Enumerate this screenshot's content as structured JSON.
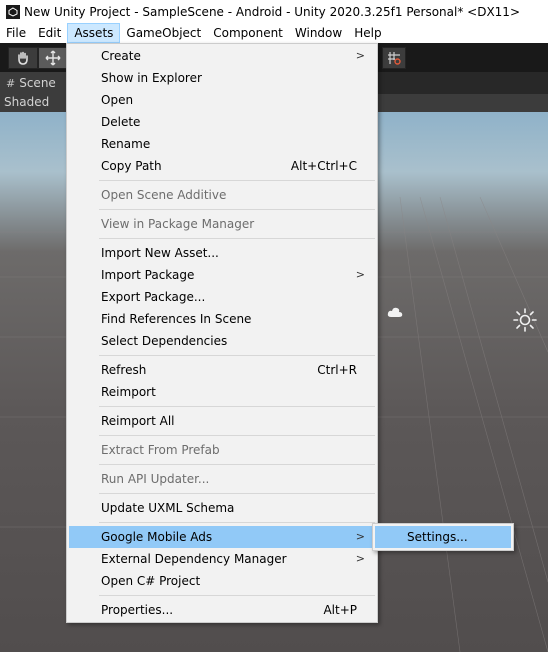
{
  "window": {
    "title": "New Unity Project - SampleScene - Android - Unity 2020.3.25f1 Personal* <DX11>",
    "app_icon": "unity-logo-icon"
  },
  "menubar": {
    "items": [
      {
        "label": "File"
      },
      {
        "label": "Edit"
      },
      {
        "label": "Assets",
        "active": true
      },
      {
        "label": "GameObject"
      },
      {
        "label": "Component"
      },
      {
        "label": "Window"
      },
      {
        "label": "Help"
      }
    ]
  },
  "toolbar": {
    "tools": [
      "hand-tool-icon",
      "move-tool-icon",
      "grid-snap-icon"
    ]
  },
  "scene_view": {
    "tab_label": "Scene",
    "shading_mode": "Shaded"
  },
  "assets_menu": {
    "items": [
      {
        "label": "Create",
        "submenu": true
      },
      {
        "label": "Show in Explorer"
      },
      {
        "label": "Open"
      },
      {
        "label": "Delete"
      },
      {
        "label": "Rename"
      },
      {
        "label": "Copy Path",
        "shortcut": "Alt+Ctrl+C"
      },
      {
        "label": "Open Scene Additive",
        "disabled": true
      },
      {
        "label": "View in Package Manager",
        "disabled": true
      },
      {
        "label": "Import New Asset..."
      },
      {
        "label": "Import Package",
        "submenu": true
      },
      {
        "label": "Export Package..."
      },
      {
        "label": "Find References In Scene"
      },
      {
        "label": "Select Dependencies"
      },
      {
        "label": "Refresh",
        "shortcut": "Ctrl+R"
      },
      {
        "label": "Reimport"
      },
      {
        "label": "Reimport All"
      },
      {
        "label": "Extract From Prefab",
        "disabled": true
      },
      {
        "label": "Run API Updater...",
        "disabled": true
      },
      {
        "label": "Update UXML Schema"
      },
      {
        "label": "Google Mobile Ads",
        "submenu": true,
        "highlighted": true
      },
      {
        "label": "External Dependency Manager",
        "submenu": true
      },
      {
        "label": "Open C# Project"
      },
      {
        "label": "Properties...",
        "shortcut": "Alt+P"
      }
    ],
    "submenu_arrow": ">"
  },
  "google_mobile_ads_submenu": {
    "items": [
      {
        "label": "Settings..."
      }
    ]
  },
  "colors": {
    "menu_background": "#f2f2f2",
    "highlight": "#91c9f7",
    "menubar_active": "#cce8ff",
    "disabled_text": "#6d6d6d"
  }
}
